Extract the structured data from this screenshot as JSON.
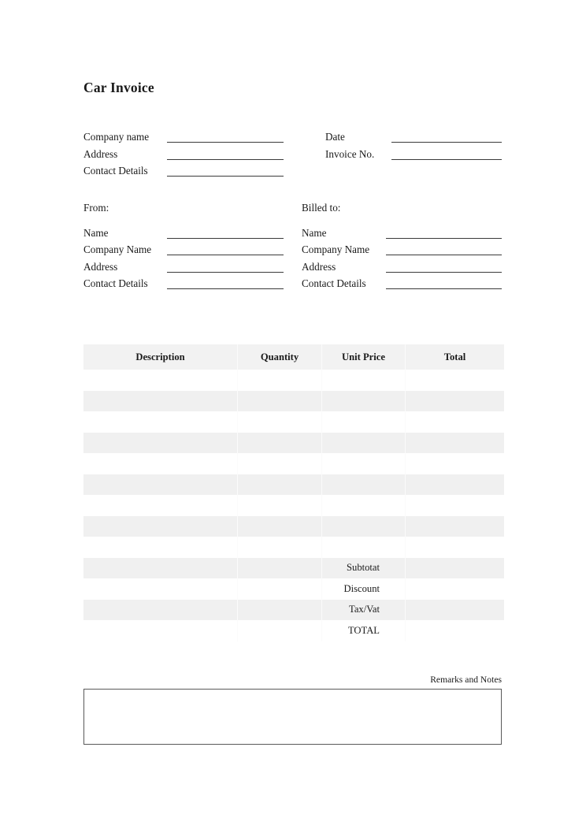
{
  "document": {
    "title": "Car Invoice"
  },
  "header": {
    "left_fields": [
      {
        "label": "Company name"
      },
      {
        "label": "Address"
      },
      {
        "label": "Contact Details"
      }
    ],
    "right_fields": [
      {
        "label": "Date"
      },
      {
        "label": "Invoice No."
      }
    ]
  },
  "parties": {
    "from": {
      "heading": "From:",
      "fields": [
        {
          "label": "Name"
        },
        {
          "label": "Company Name"
        },
        {
          "label": "Address"
        },
        {
          "label": "Contact Details"
        }
      ]
    },
    "billed_to": {
      "heading": "Billed to:",
      "fields": [
        {
          "label": "Name"
        },
        {
          "label": "Company Name"
        },
        {
          "label": "Address"
        },
        {
          "label": "Contact Details"
        }
      ]
    }
  },
  "items_table": {
    "columns": [
      "Description",
      "Quantity",
      "Unit Price",
      "Total"
    ],
    "rows": [
      {
        "description": "",
        "quantity": "",
        "unit_price": "",
        "total": ""
      },
      {
        "description": "",
        "quantity": "",
        "unit_price": "",
        "total": ""
      },
      {
        "description": "",
        "quantity": "",
        "unit_price": "",
        "total": ""
      },
      {
        "description": "",
        "quantity": "",
        "unit_price": "",
        "total": ""
      },
      {
        "description": "",
        "quantity": "",
        "unit_price": "",
        "total": ""
      },
      {
        "description": "",
        "quantity": "",
        "unit_price": "",
        "total": ""
      },
      {
        "description": "",
        "quantity": "",
        "unit_price": "",
        "total": ""
      },
      {
        "description": "",
        "quantity": "",
        "unit_price": "",
        "total": ""
      },
      {
        "description": "",
        "quantity": "",
        "unit_price": "",
        "total": ""
      }
    ],
    "summary": [
      {
        "label": "Subtotat",
        "value": ""
      },
      {
        "label": "Discount",
        "value": ""
      },
      {
        "label": "Tax/Vat",
        "value": ""
      },
      {
        "label": "TOTAL",
        "value": ""
      }
    ]
  },
  "remarks": {
    "caption": "Remarks and Notes",
    "value": ""
  },
  "colors": {
    "page_background": "#ffffff",
    "row_shade": "#f0f0f0",
    "header_shade": "#f2f2f2",
    "rule": "#3a3a3a",
    "box_border": "#595959",
    "text": "#1a1a1a"
  }
}
